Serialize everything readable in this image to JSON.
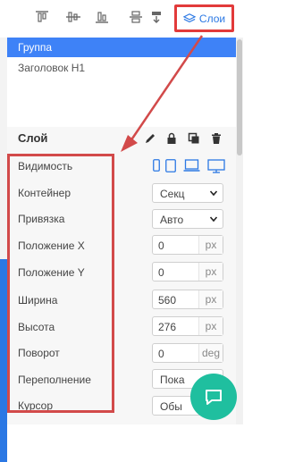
{
  "toolbar": {
    "layers_label": "Слои"
  },
  "layers": {
    "items": [
      {
        "label": "Группа",
        "selected": true
      },
      {
        "label": "Заголовок H1",
        "selected": false
      }
    ]
  },
  "panel": {
    "title": "Слой",
    "actions": [
      "pencil-icon",
      "lock-icon",
      "copy-icon",
      "trash-icon"
    ]
  },
  "properties": {
    "visibility": {
      "label": "Видимость",
      "devices": [
        "phone",
        "tablet",
        "laptop",
        "desktop"
      ]
    },
    "container": {
      "label": "Контейнер",
      "value": "Секц"
    },
    "anchor": {
      "label": "Привязка",
      "value": "Авто"
    },
    "pos_x": {
      "label": "Положение X",
      "value": "0",
      "unit": "px"
    },
    "pos_y": {
      "label": "Положение Y",
      "value": "0",
      "unit": "px"
    },
    "width": {
      "label": "Ширина",
      "value": "560",
      "unit": "px"
    },
    "height": {
      "label": "Высота",
      "value": "276",
      "unit": "px"
    },
    "rotation": {
      "label": "Поворот",
      "value": "0",
      "unit": "deg"
    },
    "overflow": {
      "label": "Переполнение",
      "value": "Пока"
    },
    "cursor": {
      "label": "Курсор",
      "value": "Обы"
    }
  },
  "colors": {
    "accent": "#2b78e4",
    "highlight": "#d24a4a",
    "chat": "#1fbf9f"
  }
}
